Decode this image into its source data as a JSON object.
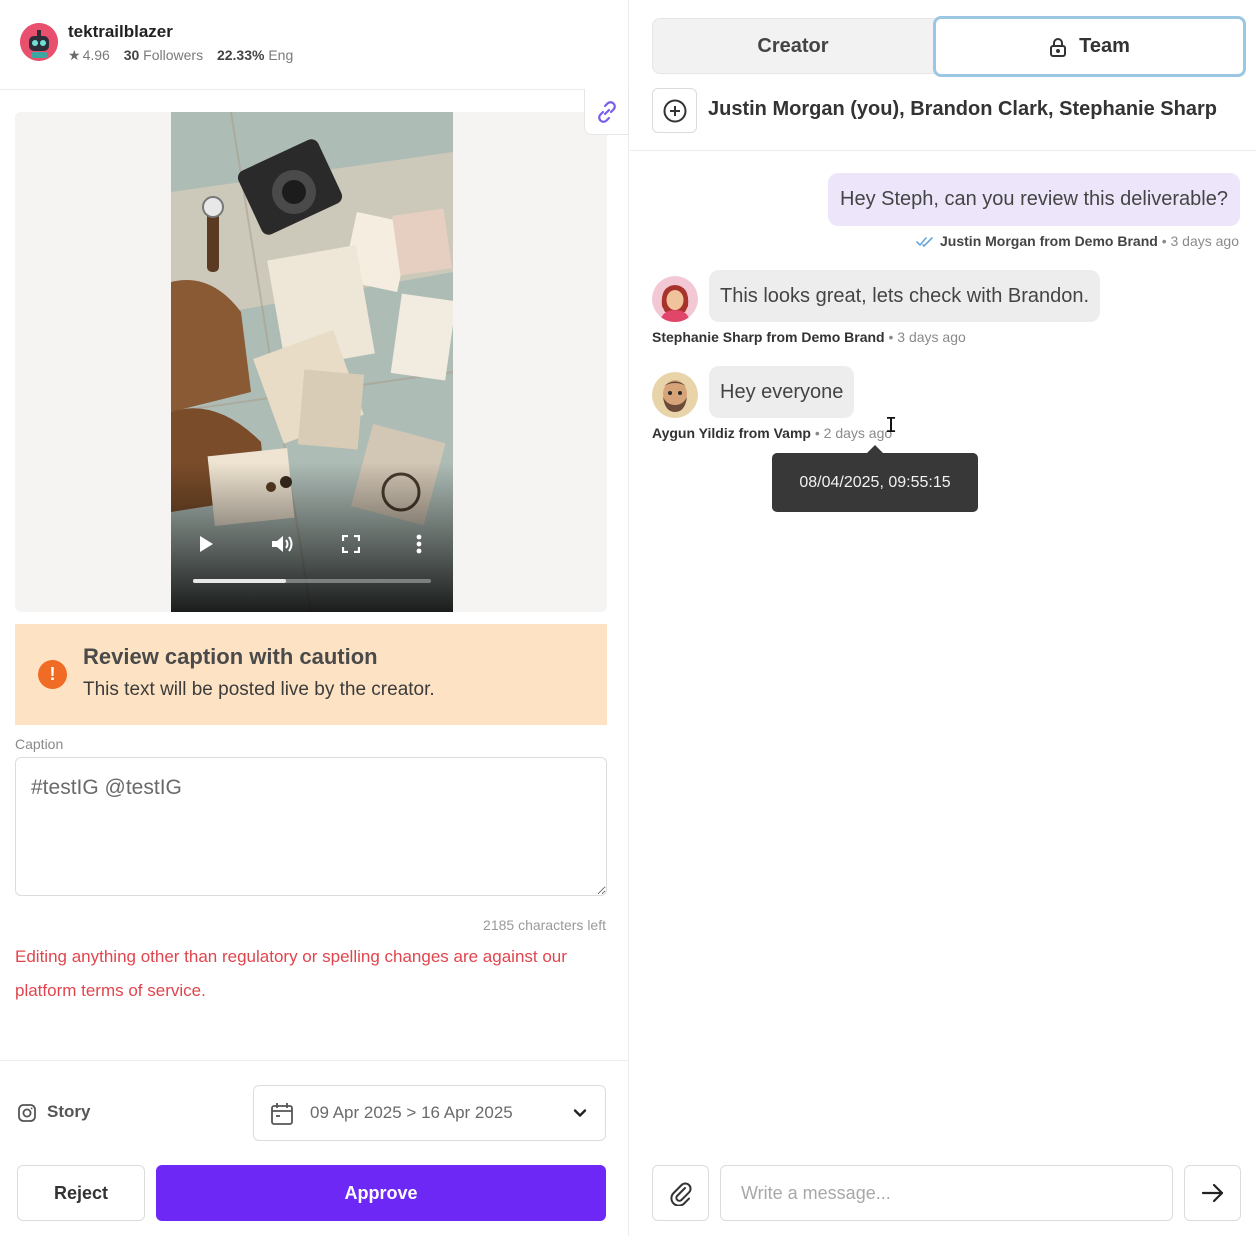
{
  "creator": {
    "username": "tektrailblazer",
    "rating": "4.96",
    "followers_count": "30",
    "followers_label": "Followers",
    "engagement_value": "22.33%",
    "engagement_label": "Eng"
  },
  "media": {
    "video_progress_fraction": 0.39
  },
  "caution": {
    "title": "Review caption with caution",
    "text": "This text will be posted live by the creator."
  },
  "caption": {
    "label": "Caption",
    "value": "#testIG @testIG",
    "chars_left": "2185 characters left"
  },
  "warning": "Editing anything other than regulatory or spelling changes are against our platform terms of service.",
  "post": {
    "type_label": "Story",
    "date_range": "09 Apr 2025 > 16 Apr 2025"
  },
  "actions": {
    "reject_label": "Reject",
    "approve_label": "Approve"
  },
  "chat": {
    "tabs": {
      "creator": "Creator",
      "team": "Team"
    },
    "members": "Justin Morgan (you), Brandon Clark, Stephanie Sharp",
    "messages": [
      {
        "text": "Hey Steph, can you review this deliverable?",
        "sender": "Justin Morgan from Demo Brand",
        "time": "3 days ago"
      },
      {
        "text": "This looks great, lets check with Brandon.",
        "sender": "Stephanie Sharp from Demo Brand",
        "time": "3 days ago"
      },
      {
        "text": "Hey everyone",
        "sender": "Aygun Yildiz from Vamp",
        "time": "2 days ago"
      }
    ],
    "tooltip": "08/04/2025, 09:55:15",
    "input_placeholder": "Write a message..."
  },
  "colors": {
    "approve": "#6d28f5",
    "caution_bg": "#fde3c4",
    "caution_icon": "#f06b24",
    "warning_text": "#e0454d",
    "outgoing_bubble": "#ede6fb",
    "incoming_bubble": "#ededed",
    "active_tab_border": "#9cc7e2"
  }
}
